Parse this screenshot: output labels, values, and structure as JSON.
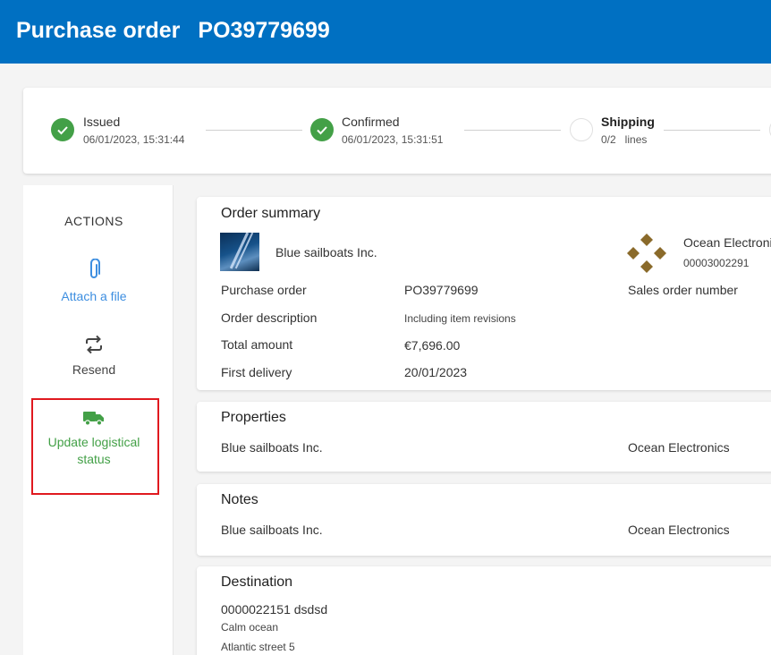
{
  "header": {
    "title": "Purchase order",
    "po_number": "PO39779699"
  },
  "status_steps": [
    {
      "label": "Issued",
      "detail": "06/01/2023, 15:31:44",
      "state": "done"
    },
    {
      "label": "Confirmed",
      "detail": "06/01/2023, 15:31:51",
      "state": "done"
    },
    {
      "label": "Shipping",
      "detail": "0/2   lines",
      "state": "pending"
    }
  ],
  "actions": {
    "heading": "ACTIONS",
    "attach": "Attach a file",
    "resend": "Resend",
    "update_line1": "Update logistical",
    "update_line2": "status"
  },
  "summary": {
    "title": "Order summary",
    "buyer_name": "Blue sailboats Inc.",
    "seller_name": "Ocean Electronics",
    "seller_id": "00003002291",
    "rows": [
      {
        "label": "Purchase order",
        "value": "PO39779699"
      },
      {
        "label": "Order description",
        "value": "Including item revisions"
      },
      {
        "label": "Total amount",
        "value": "€7,696.00"
      },
      {
        "label": "First delivery",
        "value": "20/01/2023"
      }
    ],
    "sales_order_label": "Sales order number"
  },
  "properties": {
    "title": "Properties",
    "left": "Blue sailboats Inc.",
    "right": "Ocean Electronics"
  },
  "notes": {
    "title": "Notes",
    "left": "Blue sailboats Inc.",
    "right": "Ocean Electronics"
  },
  "destination": {
    "title": "Destination",
    "code": "0000022151 dsdsd",
    "line1": "Calm ocean",
    "line2": "Atlantic street 5"
  },
  "colors": {
    "header": "#0070c2",
    "done": "#43a047",
    "attach": "#3d8ee0",
    "highlight": "#e0191f"
  }
}
